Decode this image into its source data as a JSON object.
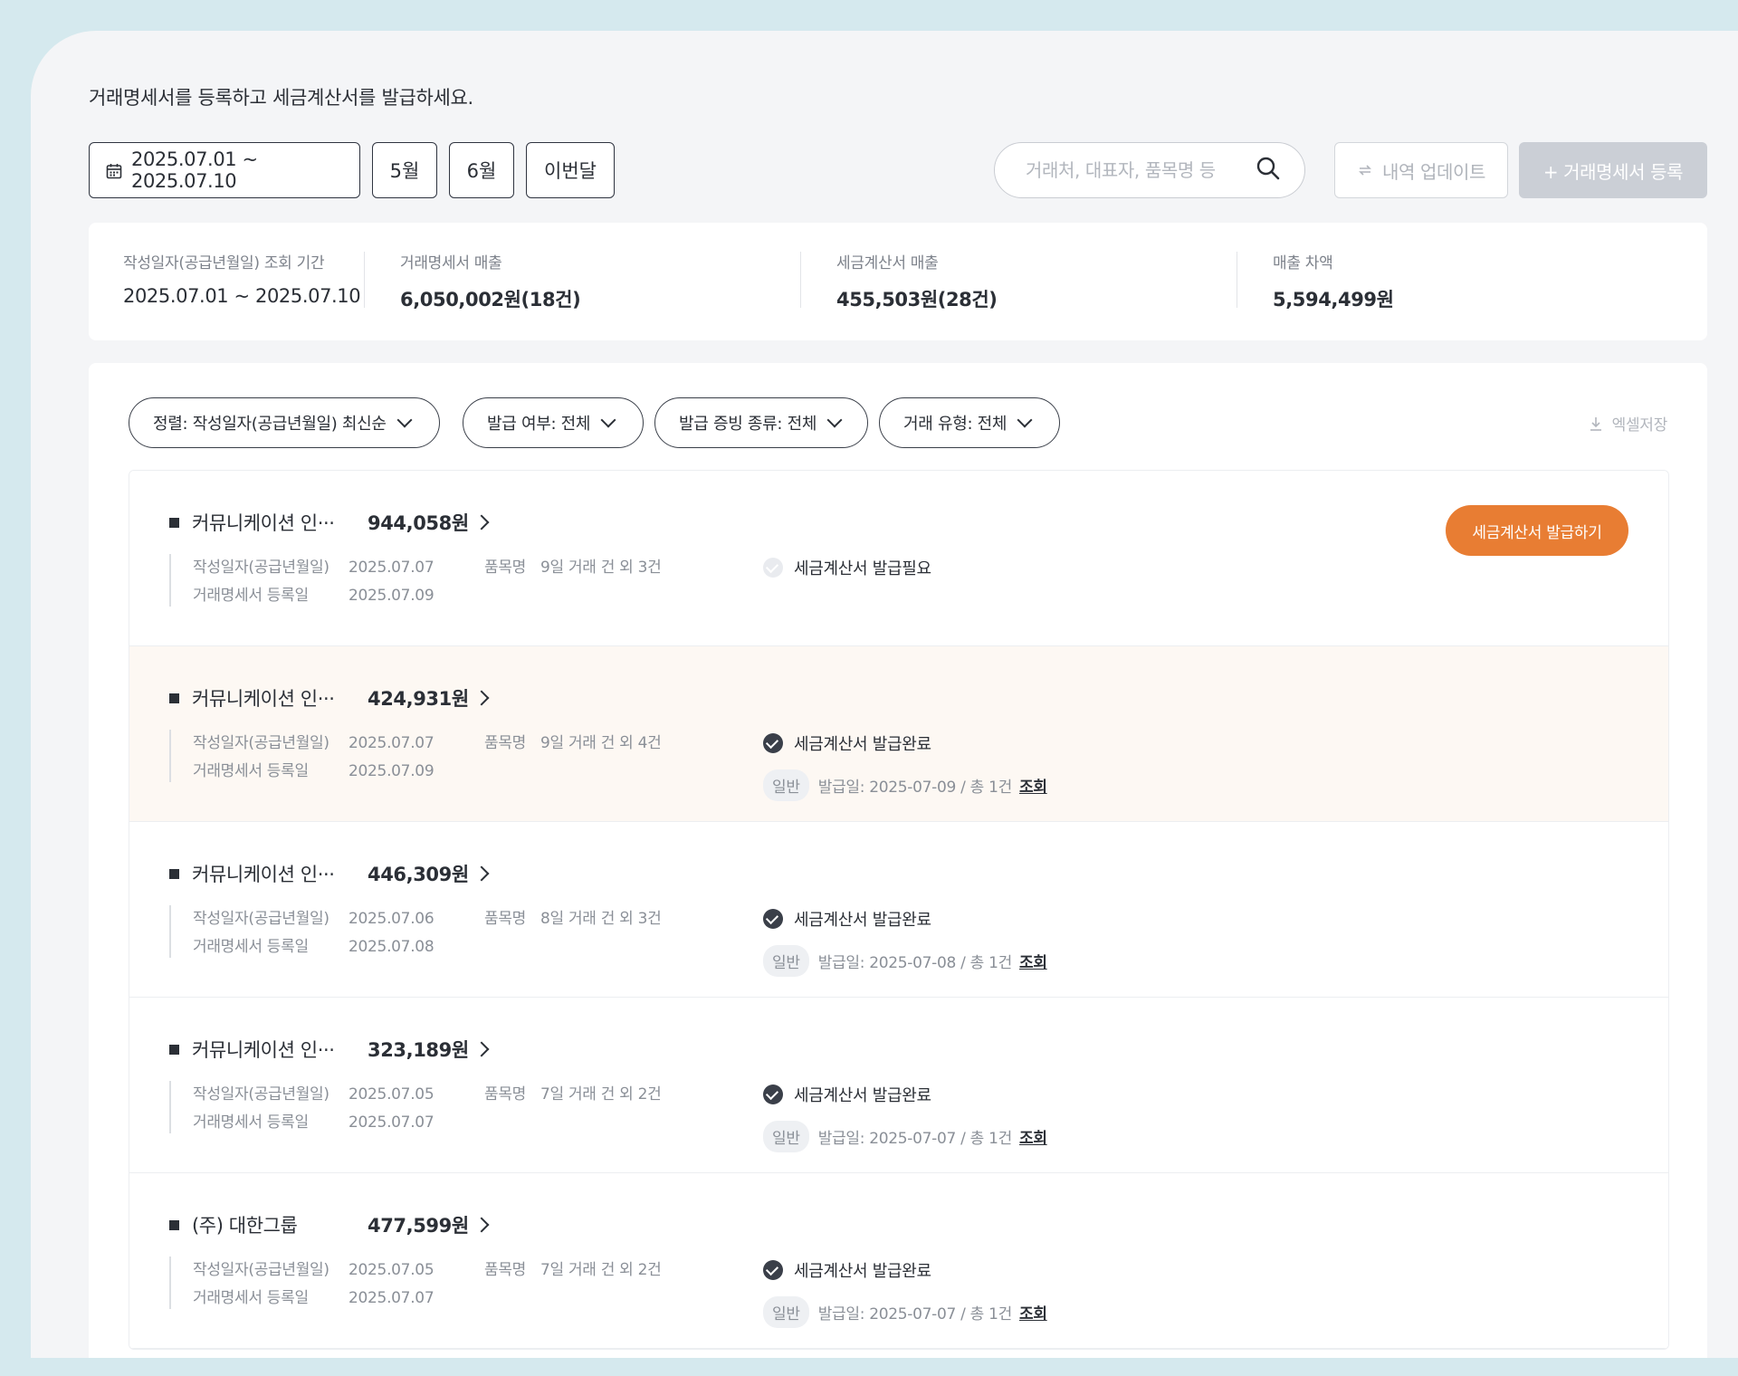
{
  "intro": "거래명세서를 등록하고 세금계산서를 발급하세요.",
  "toolbar": {
    "date_range": "2025.07.01 ~ 2025.07.10",
    "quick": [
      "5월",
      "6월",
      "이번달"
    ],
    "search_placeholder": "거래처, 대표자, 품목명 등",
    "update_label": "내역 업데이트",
    "register_label": "+ 거래명세서 등록"
  },
  "summary": [
    {
      "label": "작성일자(공급년월일) 조회 기간",
      "value": "2025.07.01 ~ 2025.07.10"
    },
    {
      "label": "거래명세서 매출",
      "value": "6,050,002원(18건)"
    },
    {
      "label": "세금계산서 매출",
      "value": "455,503원(28건)"
    },
    {
      "label": "매출 차액",
      "value": "5,594,499원"
    }
  ],
  "filters": {
    "sort": "정렬: 작성일자(공급년월일) 최신순",
    "issued": "발급 여부: 전체",
    "proof": "발급 증빙 종류: 전체",
    "type": "거래 유형: 전체",
    "excel": "엑셀저장"
  },
  "labels": {
    "written": "작성일자(공급년월일)",
    "registered": "거래명세서 등록일",
    "item": "품목명",
    "tag": "일반",
    "view": "조회",
    "issue_button": "세금계산서 발급하기"
  },
  "rows": [
    {
      "company": "커뮤니케이션 인···",
      "amount": "944,058원",
      "written": "2025.07.07",
      "registered": "2025.07.09",
      "item": "9일 거래 건 외 3건",
      "status": "세금계산서 발급필요",
      "issue_info": ""
    },
    {
      "company": "커뮤니케이션 인···",
      "amount": "424,931원",
      "written": "2025.07.07",
      "registered": "2025.07.09",
      "item": "9일 거래 건 외 4건",
      "status": "세금계산서 발급완료",
      "issue_info": "발급일: 2025-07-09 / 총 1건"
    },
    {
      "company": "커뮤니케이션 인···",
      "amount": "446,309원",
      "written": "2025.07.06",
      "registered": "2025.07.08",
      "item": "8일 거래 건 외 3건",
      "status": "세금계산서 발급완료",
      "issue_info": "발급일: 2025-07-08 / 총 1건"
    },
    {
      "company": "커뮤니케이션 인···",
      "amount": "323,189원",
      "written": "2025.07.05",
      "registered": "2025.07.07",
      "item": "7일 거래 건 외 2건",
      "status": "세금계산서 발급완료",
      "issue_info": "발급일: 2025-07-07 / 총 1건"
    },
    {
      "company": "(주) 대한그룹",
      "amount": "477,599원",
      "written": "2025.07.05",
      "registered": "2025.07.07",
      "item": "7일 거래 건 외 2건",
      "status": "세금계산서 발급완료",
      "issue_info": "발급일: 2025-07-07 / 총 1건"
    }
  ],
  "colors": {
    "accent": "#e87d33",
    "highlight_row": "#fdf8f3",
    "frame": "#d5e9ee"
  }
}
